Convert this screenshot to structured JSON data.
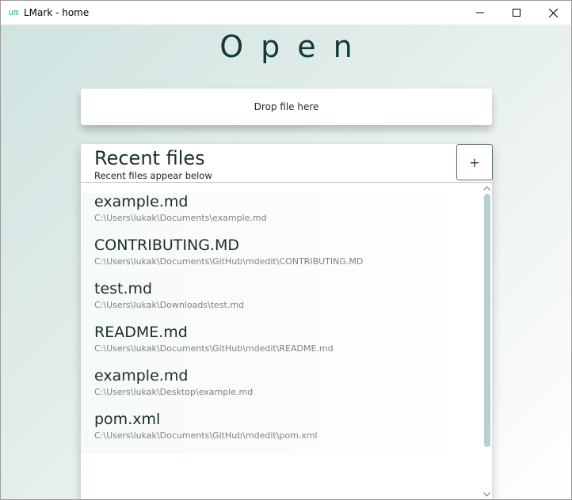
{
  "window": {
    "title": "LMark - home",
    "icon_text": "um",
    "icons": {
      "app": "lmark-logo-icon",
      "minimize": "minimize-icon",
      "maximize": "maximize-icon",
      "close": "close-icon"
    }
  },
  "page": {
    "title": "Open",
    "drop_zone_label": "Drop file here"
  },
  "recent": {
    "title": "Recent files",
    "subtitle": "Recent files appear below",
    "add_label": "+",
    "items": [
      {
        "name": "example.md",
        "path": "C:\\Users\\lukak\\Documents\\example.md"
      },
      {
        "name": "CONTRIBUTING.MD",
        "path": "C:\\Users\\lukak\\Documents\\GitHub\\mdedit\\CONTRIBUTING.MD"
      },
      {
        "name": "test.md",
        "path": "C:\\Users\\lukak\\Downloads\\test.md"
      },
      {
        "name": "README.md",
        "path": "C:\\Users\\lukak\\Documents\\GitHub\\mdedit\\README.md"
      },
      {
        "name": "example.md",
        "path": "C:\\Users\\lukak\\Desktop\\example.md"
      },
      {
        "name": "pom.xml",
        "path": "C:\\Users\\lukak\\Documents\\GitHub\\mdedit\\pom.xml"
      }
    ]
  },
  "colors": {
    "accent": "#3fb58a",
    "title_text": "#123a3a",
    "scroll_thumb": "#b6d0cf",
    "background_start": "#cfe3e0",
    "background_end": "#ffffff"
  }
}
